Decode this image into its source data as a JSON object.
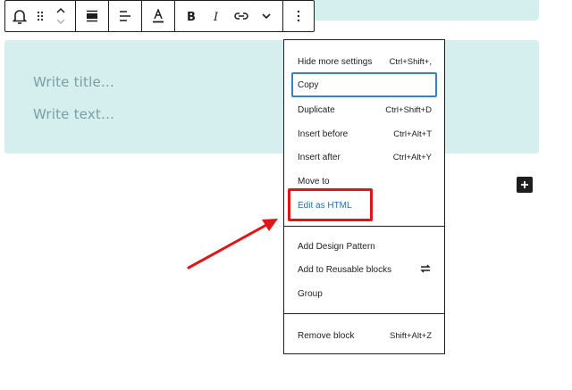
{
  "editor": {
    "title_placeholder": "Write title…",
    "text_placeholder": "Write text…"
  },
  "toolbar": {
    "groups": [
      [
        "bell-icon",
        "drag-handle-icon",
        "move-up-down-icon"
      ],
      [
        "align-block-icon"
      ],
      [
        "align-text-icon"
      ],
      [
        "text-color-icon"
      ],
      [
        "bold-icon",
        "italic-icon",
        "link-icon",
        "more-rich-text-icon"
      ],
      [
        "options-kebab-icon"
      ]
    ]
  },
  "menu": {
    "hide_settings": {
      "label": "Hide more settings",
      "shortcut": "Ctrl+Shift+,"
    },
    "copy": {
      "label": "Copy"
    },
    "duplicate": {
      "label": "Duplicate",
      "shortcut": "Ctrl+Shift+D"
    },
    "insert_before": {
      "label": "Insert before",
      "shortcut": "Ctrl+Alt+T"
    },
    "insert_after": {
      "label": "Insert after",
      "shortcut": "Ctrl+Alt+Y"
    },
    "move_to": {
      "label": "Move to"
    },
    "edit_html": {
      "label": "Edit as HTML"
    },
    "add_pattern": {
      "label": "Add Design Pattern"
    },
    "add_reusable": {
      "label": "Add to Reusable blocks",
      "icon": "reusable-icon"
    },
    "group": {
      "label": "Group"
    },
    "remove": {
      "label": "Remove block",
      "shortcut": "Shift+Alt+Z"
    }
  },
  "colors": {
    "block_bg": "#d5eeee",
    "annotation_red": "#e01616",
    "focus_blue": "#3582c4",
    "accent_link": "#2271b1"
  }
}
